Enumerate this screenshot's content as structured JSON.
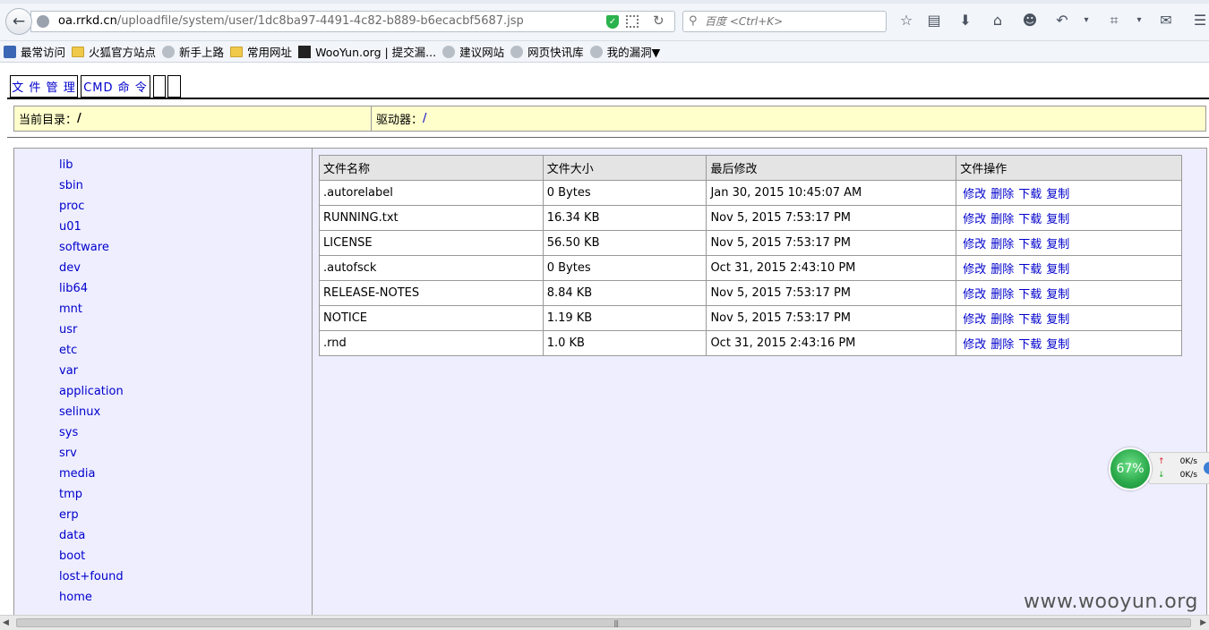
{
  "browser": {
    "url_host": "oa.rrkd.cn",
    "url_path": "/uploadfile/system/user/1dc8ba97-4491-4c82-b889-b6ecacbf5687.jsp",
    "search_placeholder": "百度 <Ctrl+K>",
    "toolbar_icons": [
      "star-icon",
      "reading-list-icon",
      "download-icon",
      "home-icon",
      "smiley-icon",
      "undo-icon",
      "crop-icon",
      "chat-icon",
      "menu-icon"
    ]
  },
  "bookmarks": [
    {
      "label": "最常访问",
      "icon": "blue"
    },
    {
      "label": "火狐官方站点",
      "icon": "folder"
    },
    {
      "label": "新手上路",
      "icon": "globe"
    },
    {
      "label": "常用网址",
      "icon": "folder"
    },
    {
      "label": "WooYun.org | 提交漏...",
      "icon": "wy"
    },
    {
      "label": "建议网站",
      "icon": "globe"
    },
    {
      "label": "网页快讯库",
      "icon": "globe"
    },
    {
      "label": "我的漏洞▼",
      "icon": "globe"
    }
  ],
  "tabs": {
    "file_manage": "文 件 管 理",
    "cmd": "CMD 命 令"
  },
  "info": {
    "current_dir_label": "当前目录：",
    "current_dir_value": "/",
    "drive_label": "驱动器：",
    "drive_value": "/"
  },
  "directories": [
    "lib",
    "sbin",
    "proc",
    "u01",
    "software",
    "dev",
    "lib64",
    "mnt",
    "usr",
    "etc",
    "var",
    "application",
    "selinux",
    "sys",
    "srv",
    "media",
    "tmp",
    "erp",
    "data",
    "boot",
    "lost+found",
    "home"
  ],
  "file_table": {
    "headers": [
      "文件名称",
      "文件大小",
      "最后修改",
      "文件操作"
    ],
    "actions": [
      "修改",
      "删除",
      "下载",
      "复制"
    ],
    "rows": [
      {
        "name": ".autorelabel",
        "size": "0 Bytes",
        "modified": "Jan 30, 2015 10:45:07 AM"
      },
      {
        "name": "RUNNING.txt",
        "size": "16.34 KB",
        "modified": "Nov 5, 2015 7:53:17 PM"
      },
      {
        "name": "LICENSE",
        "size": "56.50 KB",
        "modified": "Nov 5, 2015 7:53:17 PM"
      },
      {
        "name": ".autofsck",
        "size": "0 Bytes",
        "modified": "Oct 31, 2015 2:43:10 PM"
      },
      {
        "name": "RELEASE-NOTES",
        "size": "8.84 KB",
        "modified": "Nov 5, 2015 7:53:17 PM"
      },
      {
        "name": "NOTICE",
        "size": "1.19 KB",
        "modified": "Nov 5, 2015 7:53:17 PM"
      },
      {
        "name": ".rnd",
        "size": "1.0 KB",
        "modified": "Oct 31, 2015 2:43:16 PM"
      }
    ]
  },
  "speed_widget": {
    "percent": "67%",
    "up": "0K/s",
    "down": "0K/s"
  },
  "watermark": "www.wooyun.org"
}
